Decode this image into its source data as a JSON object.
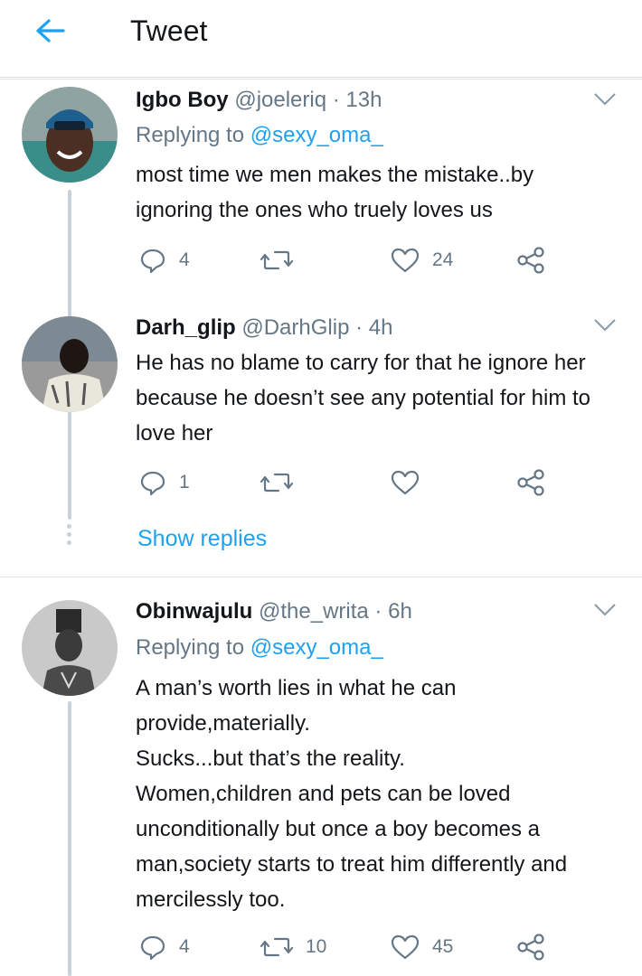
{
  "header": {
    "title": "Tweet",
    "back_icon": "arrow-left-icon"
  },
  "tweets": [
    {
      "name": "Igbo Boy",
      "handle": "@joeleriq",
      "dot": "·",
      "time": "13h",
      "replying_prefix": "Replying to",
      "replying_to": "@sexy_oma_",
      "lines": [
        "most time we men makes the mistake..by",
        "ignoring the ones who truely loves us"
      ],
      "reply_count": "4",
      "retweet_count": "",
      "like_count": "24"
    },
    {
      "name": "Darh_glip",
      "handle": "@DarhGlip",
      "dot": "·",
      "time": "4h",
      "lines": [
        "He has no blame to carry for that he ignore her",
        "because he doesn’t see any potential for him to",
        "love her"
      ],
      "reply_count": "1",
      "retweet_count": "",
      "like_count": "",
      "show_replies": "Show replies"
    },
    {
      "name": "Obinwajulu",
      "handle": "@the_writa",
      "dot": "·",
      "time": "6h",
      "replying_prefix": "Replying to",
      "replying_to": "@sexy_oma_",
      "lines": [
        "A man’s worth lies in what he can",
        "provide,materially.",
        "Sucks...but that’s the reality.",
        "Women,children and pets can be loved",
        "unconditionally but once a boy becomes a",
        "man,society starts to treat him differently and",
        "mercilessly too."
      ],
      "reply_count": "4",
      "retweet_count": "10",
      "like_count": "45"
    }
  ],
  "colors": {
    "accent": "#1da1f2",
    "secondary_text": "#657786",
    "divider": "#dfe3e8",
    "thread_line": "#c8d1da"
  }
}
